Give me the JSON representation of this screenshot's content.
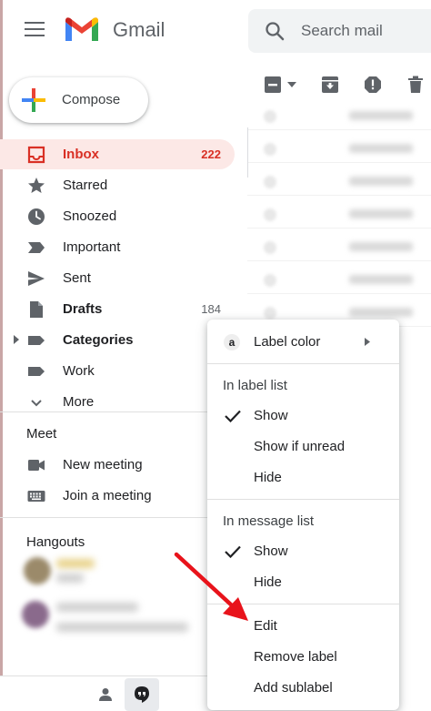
{
  "app": {
    "name": "Gmail"
  },
  "search": {
    "placeholder": "Search mail"
  },
  "toolbar": {
    "icons": [
      "select-checkbox-icon",
      "caret-down-icon",
      "archive-icon",
      "report-spam-icon",
      "delete-icon"
    ]
  },
  "compose": {
    "label": "Compose"
  },
  "nav": {
    "items": [
      {
        "label": "Inbox",
        "count": "222",
        "icon": "inbox-icon",
        "active": true
      },
      {
        "label": "Starred",
        "count": "",
        "icon": "star-icon"
      },
      {
        "label": "Snoozed",
        "count": "",
        "icon": "clock-icon"
      },
      {
        "label": "Important",
        "count": "",
        "icon": "important-icon"
      },
      {
        "label": "Sent",
        "count": "",
        "icon": "send-icon"
      },
      {
        "label": "Drafts",
        "count": "184",
        "icon": "draft-icon"
      },
      {
        "label": "Categories",
        "count": "",
        "icon": "label-icon"
      },
      {
        "label": "Work",
        "count": "",
        "icon": "label-icon"
      },
      {
        "label": "More",
        "count": "",
        "icon": "chevron-down-icon"
      }
    ]
  },
  "meet": {
    "title": "Meet",
    "items": [
      {
        "label": "New meeting",
        "icon": "videocam-icon"
      },
      {
        "label": "Join a meeting",
        "icon": "keyboard-icon"
      }
    ]
  },
  "hangouts": {
    "title": "Hangouts"
  },
  "context_menu": {
    "label_color": "Label color",
    "label_color_badge": "a",
    "in_label_list": {
      "heading": "In label list",
      "options": [
        {
          "label": "Show",
          "checked": true
        },
        {
          "label": "Show if unread",
          "checked": false
        },
        {
          "label": "Hide",
          "checked": false
        }
      ]
    },
    "in_message_list": {
      "heading": "In message list",
      "options": [
        {
          "label": "Show",
          "checked": true
        },
        {
          "label": "Hide",
          "checked": false
        }
      ]
    },
    "actions": [
      {
        "label": "Edit"
      },
      {
        "label": "Remove label"
      },
      {
        "label": "Add sublabel"
      }
    ]
  },
  "colors": {
    "accent_red": "#d93025",
    "active_bg": "#fce8e6",
    "annotation_arrow": "#e8131b"
  }
}
